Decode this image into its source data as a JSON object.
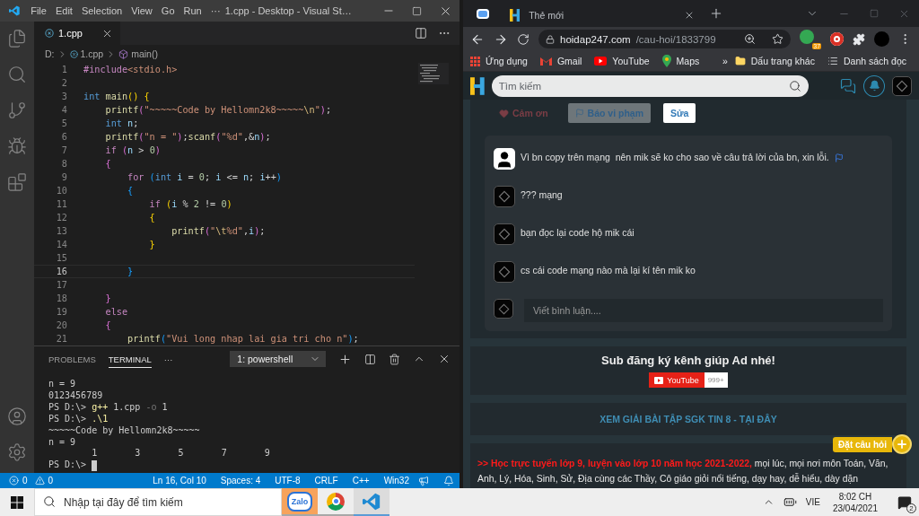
{
  "vscode": {
    "menu": [
      "File",
      "Edit",
      "Selection",
      "View",
      "Go",
      "Run",
      "···"
    ],
    "title": "1.cpp - Desktop - Visual St…",
    "editor_tab": "1.cpp",
    "breadcrumb": [
      "D:",
      "1.cpp",
      "main()"
    ],
    "code_lines": [
      {
        "number": "1",
        "current": false,
        "tokens": [
          {
            "kind": "control",
            "text": "#include"
          },
          {
            "kind": "string",
            "text": "<stdio.h>"
          }
        ]
      },
      {
        "number": "2",
        "current": false
      },
      {
        "number": "3",
        "current": false,
        "tokens": [
          {
            "kind": "keyword",
            "text": "int"
          },
          {
            "kind": "func",
            "text": " main"
          },
          {
            "kind": "bracket1",
            "text": "()"
          },
          {
            "kind": "bracket1",
            "text": " {"
          }
        ]
      },
      {
        "number": "4",
        "current": false,
        "tokens": [
          {
            "kind": "func",
            "text": "    printf"
          },
          {
            "kind": "bracket2",
            "text": "("
          },
          {
            "kind": "string",
            "text": "\"~~~~~Code by Hellomn2k8~~~~~"
          },
          {
            "kind": "escape",
            "text": "\\n"
          },
          {
            "kind": "string",
            "text": "\""
          },
          {
            "kind": "bracket2",
            "text": ")"
          },
          {
            "kind": "plain",
            "text": ";"
          }
        ]
      },
      {
        "number": "5",
        "current": false,
        "tokens": [
          {
            "kind": "keyword",
            "text": "    int"
          },
          {
            "kind": "var",
            "text": " n"
          },
          {
            "kind": "plain",
            "text": ";"
          }
        ]
      },
      {
        "number": "6",
        "current": false,
        "tokens": [
          {
            "kind": "func",
            "text": "    printf"
          },
          {
            "kind": "bracket2",
            "text": "("
          },
          {
            "kind": "string",
            "text": "\"n = \""
          },
          {
            "kind": "bracket2",
            "text": ")"
          },
          {
            "kind": "plain",
            "text": ";"
          },
          {
            "kind": "func",
            "text": "scanf"
          },
          {
            "kind": "bracket2",
            "text": "("
          },
          {
            "kind": "string",
            "text": "\"%d\""
          },
          {
            "kind": "plain",
            "text": ",&"
          },
          {
            "kind": "var",
            "text": "n"
          },
          {
            "kind": "bracket2",
            "text": ")"
          },
          {
            "kind": "plain",
            "text": ";"
          }
        ]
      },
      {
        "number": "7",
        "current": false,
        "tokens": [
          {
            "kind": "control",
            "text": "    if"
          },
          {
            "kind": "bracket2",
            "text": " ("
          },
          {
            "kind": "var",
            "text": "n"
          },
          {
            "kind": "plain",
            "text": " > "
          },
          {
            "kind": "number",
            "text": "0"
          },
          {
            "kind": "bracket2",
            "text": ")"
          }
        ]
      },
      {
        "number": "8",
        "current": false,
        "tokens": [
          {
            "kind": "bracket2",
            "text": "    {"
          }
        ]
      },
      {
        "number": "9",
        "current": false,
        "tokens": [
          {
            "kind": "control",
            "text": "        for"
          },
          {
            "kind": "bracket3",
            "text": " ("
          },
          {
            "kind": "keyword",
            "text": "int"
          },
          {
            "kind": "var",
            "text": " i"
          },
          {
            "kind": "plain",
            "text": " = "
          },
          {
            "kind": "number",
            "text": "0"
          },
          {
            "kind": "plain",
            "text": "; "
          },
          {
            "kind": "var",
            "text": "i"
          },
          {
            "kind": "plain",
            "text": " <= "
          },
          {
            "kind": "var",
            "text": "n"
          },
          {
            "kind": "plain",
            "text": "; "
          },
          {
            "kind": "var",
            "text": "i"
          },
          {
            "kind": "plain",
            "text": "++"
          },
          {
            "kind": "bracket3",
            "text": ")"
          }
        ]
      },
      {
        "number": "10",
        "current": false,
        "tokens": [
          {
            "kind": "bracket3",
            "text": "        {"
          }
        ]
      },
      {
        "number": "11",
        "current": false,
        "tokens": [
          {
            "kind": "control",
            "text": "            if"
          },
          {
            "kind": "bracket1",
            "text": " ("
          },
          {
            "kind": "var",
            "text": "i"
          },
          {
            "kind": "plain",
            "text": " % "
          },
          {
            "kind": "number",
            "text": "2"
          },
          {
            "kind": "plain",
            "text": " != "
          },
          {
            "kind": "number",
            "text": "0"
          },
          {
            "kind": "bracket1",
            "text": ")"
          }
        ]
      },
      {
        "number": "12",
        "current": false,
        "tokens": [
          {
            "kind": "bracket1",
            "text": "            {"
          }
        ]
      },
      {
        "number": "13",
        "current": false,
        "tokens": [
          {
            "kind": "func",
            "text": "                printf"
          },
          {
            "kind": "bracket2",
            "text": "("
          },
          {
            "kind": "string",
            "text": "\""
          },
          {
            "kind": "escape",
            "text": "\\t"
          },
          {
            "kind": "string",
            "text": "%d\""
          },
          {
            "kind": "plain",
            "text": ","
          },
          {
            "kind": "var",
            "text": "i"
          },
          {
            "kind": "bracket2",
            "text": ")"
          },
          {
            "kind": "plain",
            "text": ";"
          }
        ]
      },
      {
        "number": "14",
        "current": false,
        "tokens": [
          {
            "kind": "bracket1",
            "text": "            }"
          }
        ]
      },
      {
        "number": "15",
        "current": false
      },
      {
        "number": "16",
        "current": true,
        "tokens": [
          {
            "kind": "bracket3",
            "text": "        }"
          }
        ]
      },
      {
        "number": "17",
        "current": false
      },
      {
        "number": "18",
        "current": false,
        "tokens": [
          {
            "kind": "bracket2",
            "text": "    }"
          }
        ]
      },
      {
        "number": "19",
        "current": false,
        "tokens": [
          {
            "kind": "control",
            "text": "    else"
          }
        ]
      },
      {
        "number": "20",
        "current": false,
        "tokens": [
          {
            "kind": "bracket2",
            "text": "    {"
          }
        ]
      },
      {
        "number": "21",
        "current": false,
        "tokens": [
          {
            "kind": "func",
            "text": "        printf"
          },
          {
            "kind": "bracket3",
            "text": "("
          },
          {
            "kind": "string",
            "text": "\"Vui long nhap lai gia tri cho n\""
          },
          {
            "kind": "bracket3",
            "text": ")"
          },
          {
            "kind": "plain",
            "text": ";"
          }
        ]
      }
    ],
    "panel_tabs": [
      {
        "label": "PROBLEMS",
        "selected": false
      },
      {
        "label": "TERMINAL",
        "selected": true
      }
    ],
    "panel_more": "···",
    "terminal_select": "1: powershell",
    "terminal_lines": [
      [
        {
          "kind": "plain",
          "text": "n = 9"
        }
      ],
      [
        {
          "kind": "plain",
          "text": "0123456789"
        }
      ],
      [
        {
          "kind": "plain",
          "text": "PS D:\\> "
        },
        {
          "kind": "cmd",
          "text": "g++"
        },
        {
          "kind": "plain",
          "text": " 1.cpp "
        },
        {
          "kind": "flag",
          "text": "-o"
        },
        {
          "kind": "plain",
          "text": " 1"
        }
      ],
      [
        {
          "kind": "plain",
          "text": "PS D:\\> "
        },
        {
          "kind": "cmd",
          "text": ".\\1"
        }
      ],
      [
        {
          "kind": "plain",
          "text": "~~~~~Code by Hellomn2k8~~~~~"
        }
      ],
      [
        {
          "kind": "plain",
          "text": "n = 9"
        }
      ],
      [
        {
          "kind": "plain",
          "text": "\t1\t3\t5\t7\t9"
        }
      ],
      [
        {
          "kind": "plain",
          "text": "PS D:\\> "
        }
      ]
    ],
    "status": {
      "errors": "0",
      "warnings": "0",
      "items": [
        "Ln 16, Col 10",
        "Spaces: 4",
        "UTF-8",
        "CRLF",
        "C++",
        "Win32"
      ]
    }
  },
  "browser": {
    "tab_title": "Thẻ mới",
    "url_host": "hoidap247.com",
    "url_path": "/cau-hoi/1833799",
    "extension_badge": "37",
    "bookmarks": [
      {
        "kind": "apps",
        "label": "Ứng dụng"
      },
      {
        "kind": "gmail",
        "label": "Gmail"
      },
      {
        "kind": "youtube",
        "label": "YouTube"
      },
      {
        "kind": "maps",
        "label": "Maps"
      }
    ],
    "bookmarks_more": "»",
    "other_bookmarks": "Dấu trang khác",
    "reading_list": "Danh sách đọc"
  },
  "site": {
    "search_placeholder": "Tìm kiếm",
    "actions": [
      {
        "kind": "thanks",
        "label": "Cảm ơn"
      },
      {
        "kind": "report",
        "label": "Báo vi phạm"
      },
      {
        "kind": "edit",
        "label": "Sửa"
      }
    ],
    "comments": [
      {
        "kind": "silhouette",
        "text": "Vì bn copy trên mạng  nên mik sẽ ko cho sao về câu trả lời của bn, xin lỗi.",
        "flagged": true
      },
      {
        "kind": "dark",
        "text": "??? mạng",
        "flagged": false
      },
      {
        "kind": "dark",
        "text": "bạn đọc lại code hộ mik cái",
        "flagged": false
      },
      {
        "kind": "dark",
        "text": "cs cái code mạng nào mà lại kí tên mik ko",
        "flagged": false
      }
    ],
    "comment_placeholder": "Viết bình luận....",
    "subscribe_title": "Sub đăng ký kênh giúp Ad nhé!",
    "youtube_label": "YouTube",
    "youtube_count": "999+",
    "solutions_link": "XEM GIẢI BÀI TẬP SGK TIN 8 - TẠI ĐÂY",
    "promo": "**>> Học trực tuyến lớp 9, luyện vào lớp 10 năm học 2021-2022,** mọi lúc, mọi nơi môn Toán, Văn, Anh, Lý, Hóa, Sinh, Sử, Địa cùng các Thầy, Cô giáo giỏi nổi tiếng, dạy hay, dễ hiểu, dày dặn",
    "ask_button": "Đặt câu hỏi"
  },
  "taskbar": {
    "search_placeholder": "Nhập tại đây để tìm kiếm",
    "apps": [
      {
        "kind": "zalo",
        "label": "Zalo",
        "attention": true,
        "active": false
      },
      {
        "kind": "chrome",
        "attention": false,
        "active": false
      },
      {
        "kind": "vscode",
        "attention": false,
        "active": true
      }
    ],
    "language": "VIE",
    "time": "8:02 CH",
    "date": "23/04/2021",
    "notifications": "2"
  }
}
